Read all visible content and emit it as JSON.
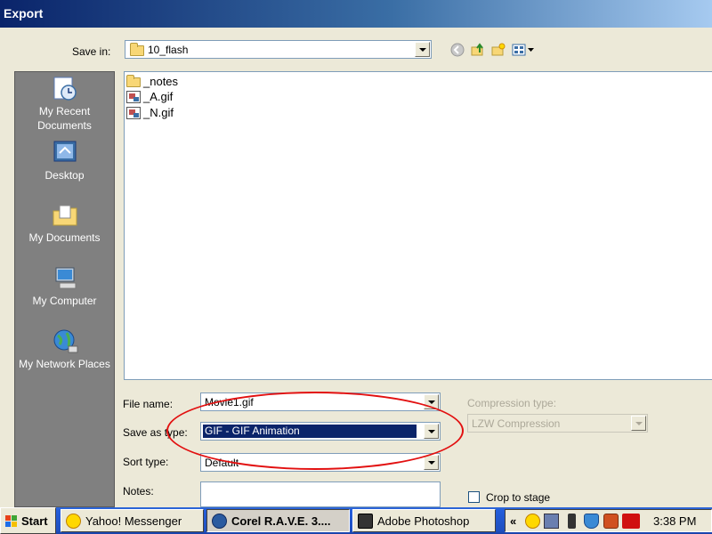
{
  "window": {
    "title": "Export"
  },
  "save_in": {
    "label": "Save in:",
    "value": "10_flash",
    "toolbar_icons": [
      "back-icon",
      "up-folder-icon",
      "new-folder-icon",
      "views-menu-icon"
    ]
  },
  "places": [
    {
      "label": "My Recent Documents",
      "icon": "recent-documents-icon"
    },
    {
      "label": "Desktop",
      "icon": "desktop-icon"
    },
    {
      "label": "My Documents",
      "icon": "my-documents-icon"
    },
    {
      "label": "My Computer",
      "icon": "my-computer-icon"
    },
    {
      "label": "My Network Places",
      "icon": "network-places-icon"
    }
  ],
  "files": [
    {
      "name": "_notes",
      "type": "folder"
    },
    {
      "name": "_A.gif",
      "type": "gif"
    },
    {
      "name": "_N.gif",
      "type": "gif"
    }
  ],
  "form": {
    "file_name": {
      "label": "File name:",
      "value": "Movie1.gif"
    },
    "save_as_type": {
      "label": "Save as type:",
      "value": "GIF - GIF Animation"
    },
    "sort_type": {
      "label": "Sort type:",
      "value": "Default"
    },
    "notes": {
      "label": "Notes:",
      "value": ""
    },
    "compression_type": {
      "label": "Compression type:",
      "value": "LZW Compression",
      "disabled": true
    },
    "crop_to_stage": {
      "label": "Crop to stage",
      "checked": false
    }
  },
  "taskbar": {
    "start_label": "Start",
    "tasks": [
      {
        "label": "Yahoo! Messenger",
        "icon": "yahoo-messenger-icon",
        "active": false
      },
      {
        "label": "Corel R.A.V.E. 3....",
        "icon": "corel-rave-icon",
        "active": true
      },
      {
        "label": "Adobe Photoshop",
        "icon": "photoshop-icon",
        "active": false
      }
    ],
    "tray_chevron": "«",
    "tray_icons": [
      "messenger-tray-icon",
      "network-tray-icon",
      "traffic-light-tray-icon",
      "shield-tray-icon",
      "app-tray-icon",
      "ati-tray-icon"
    ],
    "clock": "3:38 PM"
  },
  "colors": {
    "highlight": "#0a246a",
    "annotation": "#e21010",
    "places_bar": "#808080"
  }
}
